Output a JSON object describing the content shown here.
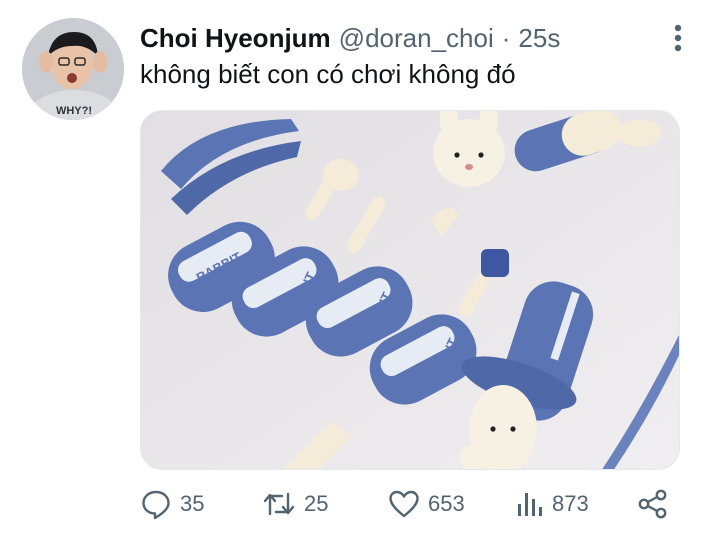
{
  "tweet": {
    "author": {
      "display_name": "Choi Hyeonjum",
      "handle": "@doran_choi",
      "separator": "·",
      "timestamp": "25s"
    },
    "text": "không biết con có chơi không đó",
    "media": {
      "kind": "photo",
      "printed_text": [
        "RABBIT",
        "RABBIT",
        "RABBIT",
        "RABBIT",
        "RABBIT"
      ]
    },
    "metrics": {
      "replies": "35",
      "retweets": "25",
      "likes": "653",
      "views": "873"
    }
  },
  "colors": {
    "text_primary": "#0f1419",
    "text_secondary": "#536471",
    "toy_blue": "#5a74b4",
    "toy_cream": "#f4ecd9",
    "photo_bg": "#ece9ec"
  },
  "icons": {
    "more": "more-vertical-icon",
    "reply": "reply-icon",
    "retweet": "retweet-icon",
    "like": "heart-icon",
    "views": "views-icon",
    "share": "share-icon"
  }
}
